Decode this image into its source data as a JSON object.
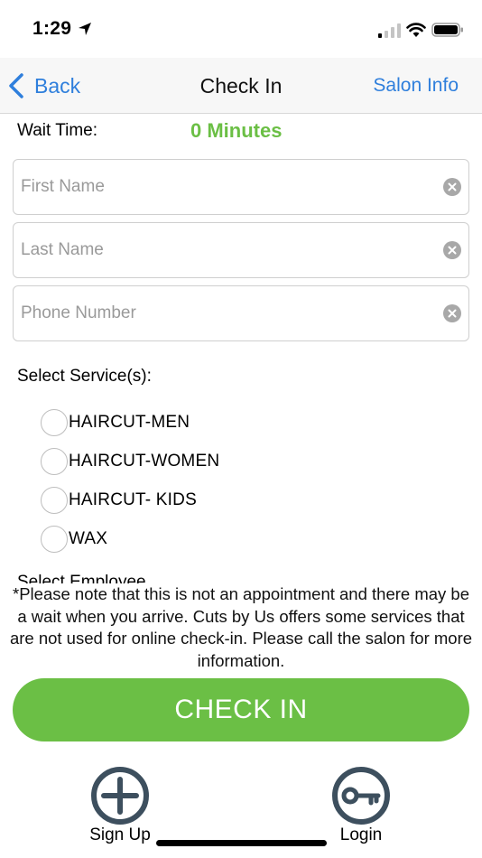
{
  "status_bar": {
    "time": "1:29"
  },
  "nav": {
    "back_label": "Back",
    "title": "Check In",
    "right_label": "Salon Info"
  },
  "wait": {
    "label": "Wait Time:",
    "value": "0 Minutes"
  },
  "form": {
    "first_name": {
      "placeholder": "First Name",
      "value": ""
    },
    "last_name": {
      "placeholder": "Last Name",
      "value": ""
    },
    "phone": {
      "placeholder": "Phone Number",
      "value": ""
    }
  },
  "services": {
    "label": "Select Service(s):",
    "items": [
      {
        "label": "HAIRCUT-MEN",
        "selected": false
      },
      {
        "label": "HAIRCUT-WOMEN",
        "selected": false
      },
      {
        "label": "HAIRCUT- KIDS",
        "selected": false
      },
      {
        "label": "WAX",
        "selected": false
      }
    ]
  },
  "employee": {
    "label": "Select Employee"
  },
  "note": "*Please note that this is not an appointment and there may be a wait when you arrive. Cuts by Us offers some services that are not used for online check-in. Please call the salon for more information.",
  "checkin_button": "CHECK IN",
  "bottom": {
    "sign_up": "Sign Up",
    "login": "Login"
  },
  "colors": {
    "accent_green": "#6bbf45",
    "link_blue": "#2f7fdc",
    "icon_slate": "#3d4f5e"
  }
}
